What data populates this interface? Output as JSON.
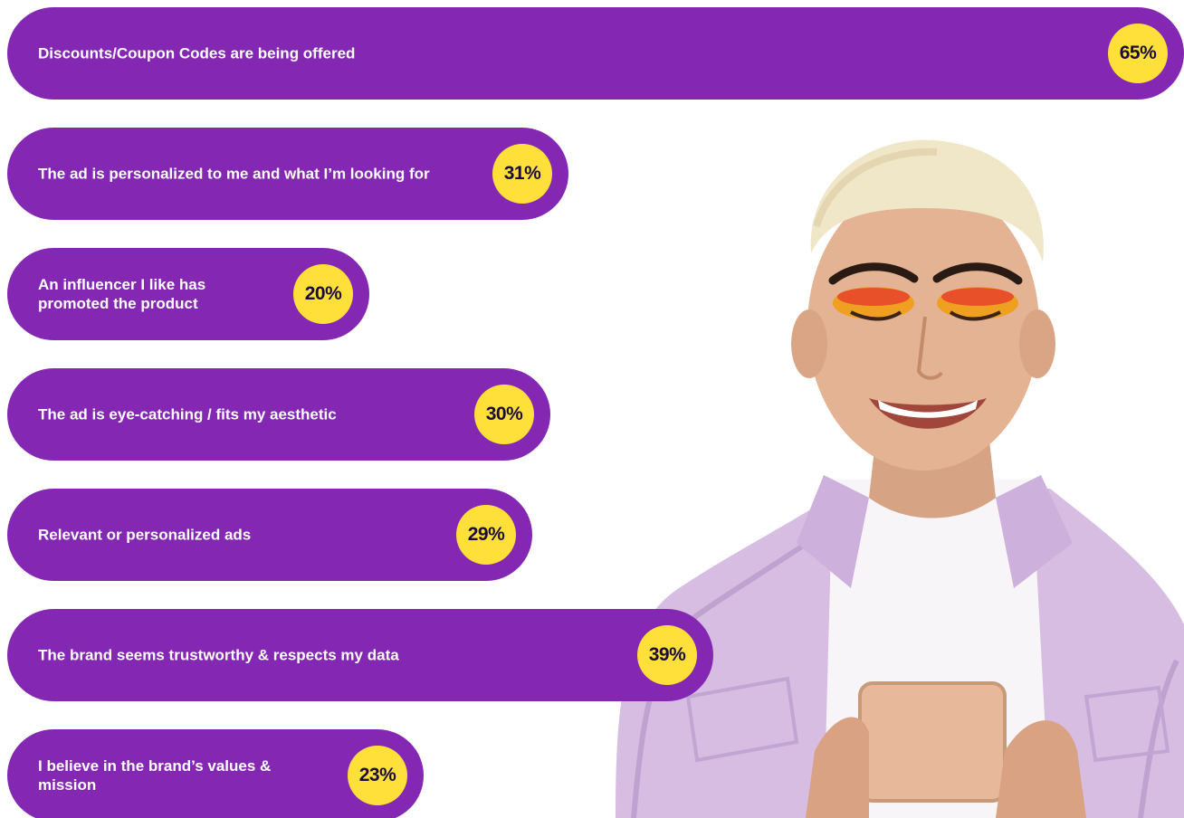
{
  "chart_data": {
    "type": "bar",
    "orientation": "horizontal",
    "categories": [
      "Discounts/Coupon Codes are being offered",
      "The ad is personalized to me and what I’m looking for",
      "An influencer I like has promoted the product",
      "The ad is eye-catching / fits my aesthetic",
      "Relevant or personalized ads",
      "The brand seems trustworthy & respects my data",
      "I believe in the brand’s values & mission"
    ],
    "values": [
      65,
      31,
      20,
      30,
      29,
      39,
      23
    ],
    "value_labels": [
      "65%",
      "31%",
      "20%",
      "30%",
      "29%",
      "39%",
      "23%"
    ],
    "units": "%",
    "title": "",
    "xlabel": "",
    "ylabel": ""
  },
  "colors": {
    "bar": "#8428b4",
    "badge": "#ffe03a",
    "badge_text": "#1a0b3a",
    "label_text": "#ffffff"
  },
  "bars": [
    {
      "label": "Discounts/Coupon Codes are being offered",
      "value_label": "65%"
    },
    {
      "label": "The ad is personalized to me and what I’m looking for",
      "value_label": "31%"
    },
    {
      "label": "An influencer I like has promoted the product",
      "value_label": "20%"
    },
    {
      "label": "The ad is eye-catching / fits my aesthetic",
      "value_label": "30%"
    },
    {
      "label": "Relevant or personalized ads",
      "value_label": "29%"
    },
    {
      "label": "The brand seems trustworthy & respects my data",
      "value_label": "39%"
    },
    {
      "label": "I believe in the brand’s values & mission",
      "value_label": "23%"
    }
  ]
}
